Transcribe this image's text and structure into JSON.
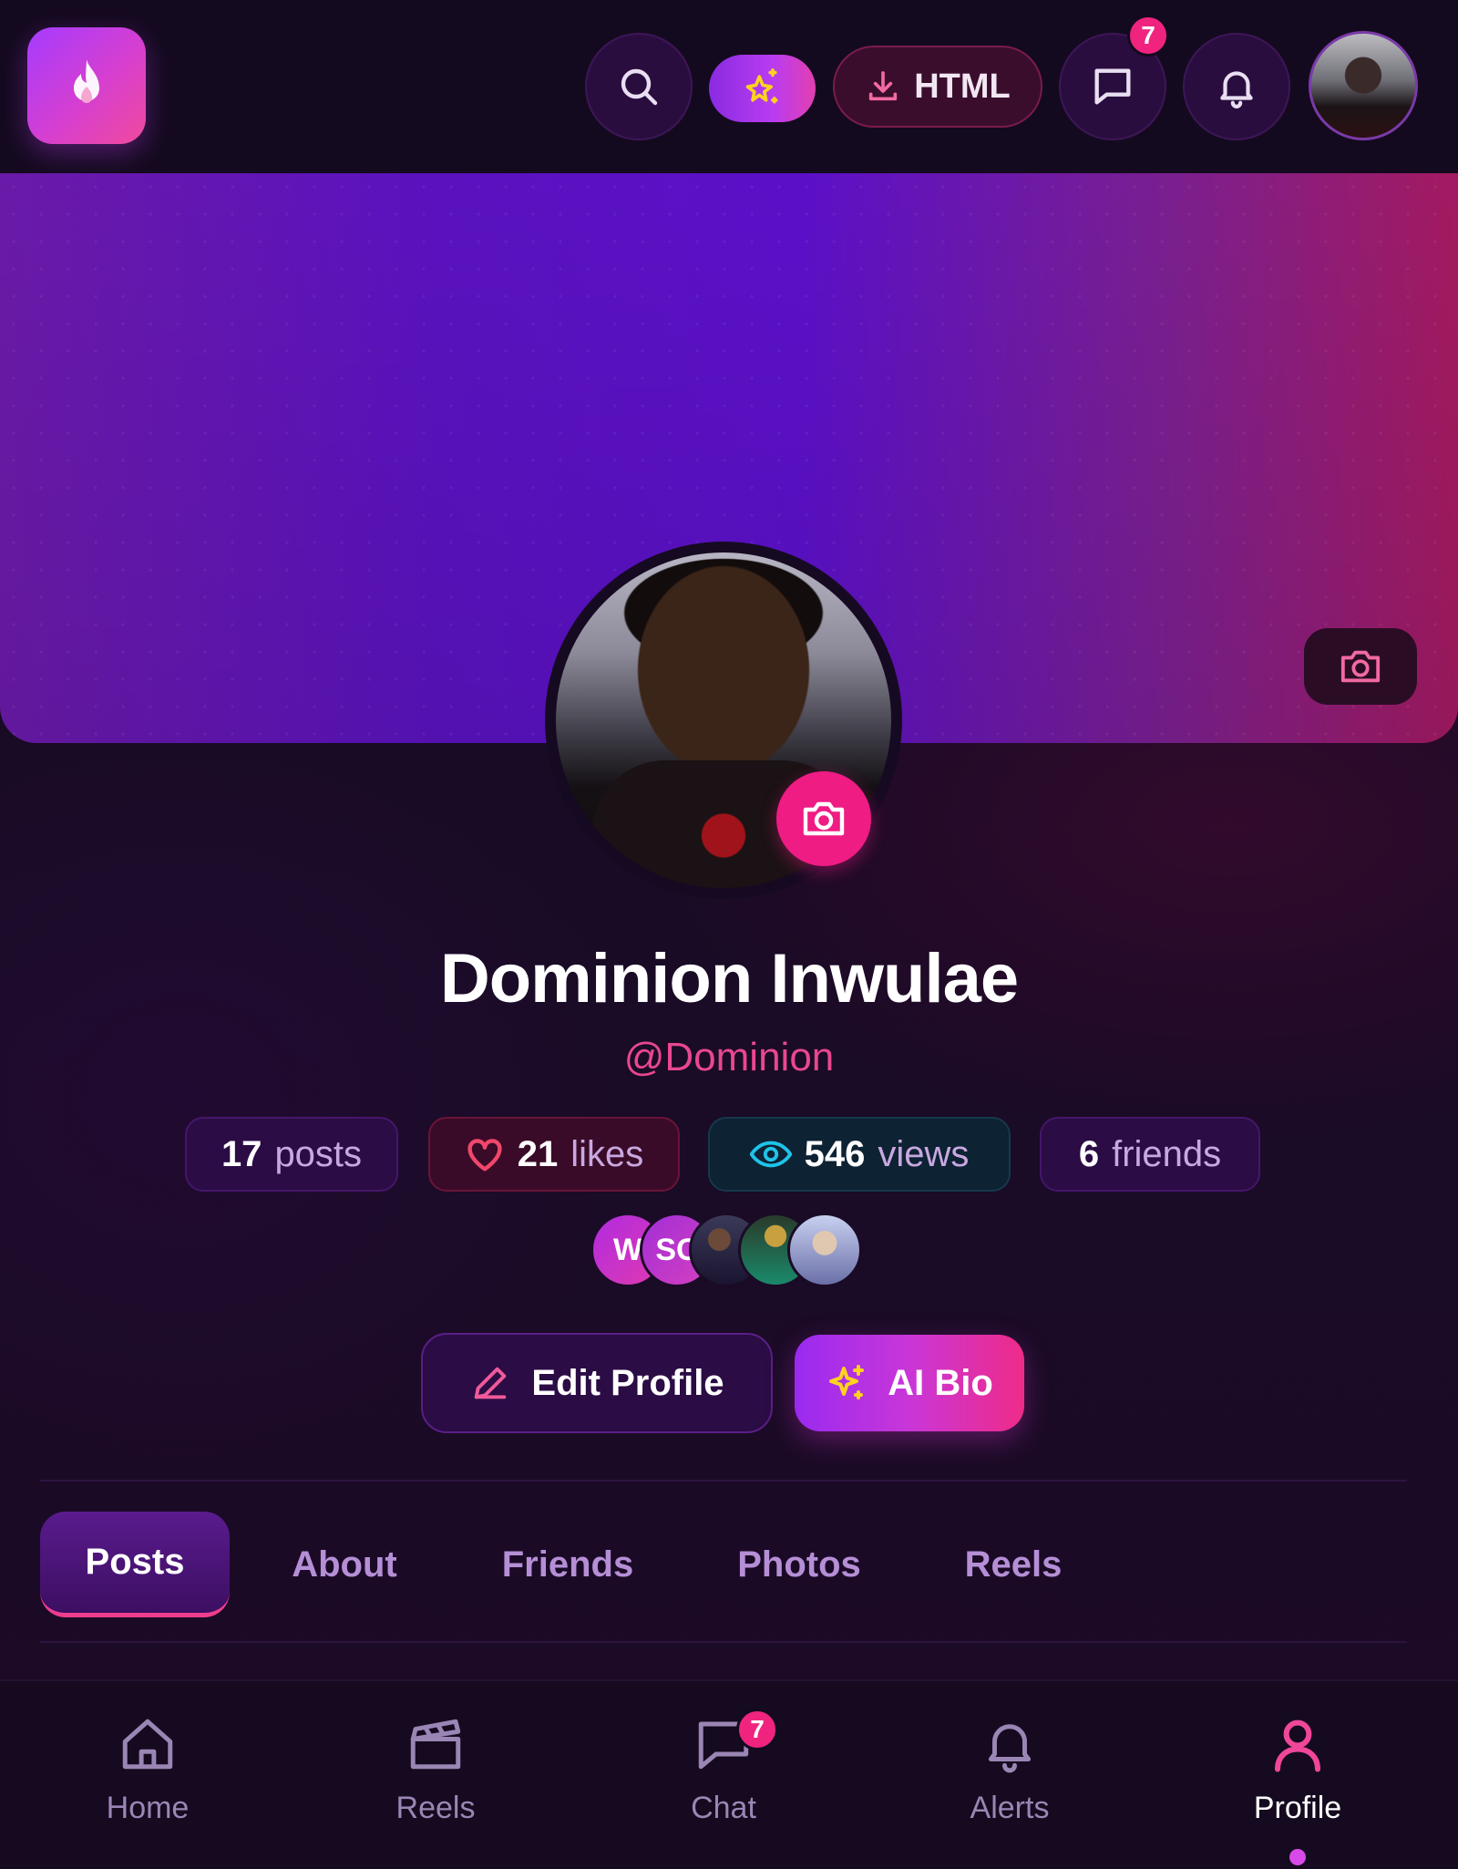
{
  "header": {
    "html_button_label": "HTML",
    "messages_badge": "7",
    "icons": [
      "flame-logo-icon",
      "search-icon",
      "magic-star-icon",
      "download-icon",
      "chat-icon",
      "bell-icon",
      "avatar"
    ]
  },
  "profile": {
    "name": "Dominion Inwulae",
    "handle": "@Dominion"
  },
  "stats": {
    "posts": {
      "value": "17",
      "label": "posts"
    },
    "likes": {
      "value": "21",
      "label": "likes"
    },
    "views": {
      "value": "546",
      "label": "views"
    },
    "friends": {
      "value": "6",
      "label": "friends"
    }
  },
  "friend_avatars": [
    {
      "initials": "W"
    },
    {
      "initials": "SC"
    },
    {
      "initials": ""
    },
    {
      "initials": ""
    },
    {
      "initials": ""
    }
  ],
  "actions": {
    "edit_profile": "Edit Profile",
    "ai_bio": "AI Bio"
  },
  "tabs": [
    {
      "label": "Posts",
      "active": true
    },
    {
      "label": "About"
    },
    {
      "label": "Friends"
    },
    {
      "label": "Photos"
    },
    {
      "label": "Reels"
    }
  ],
  "bottom_nav": [
    {
      "label": "Home"
    },
    {
      "label": "Reels"
    },
    {
      "label": "Chat",
      "badge": "7"
    },
    {
      "label": "Alerts"
    },
    {
      "label": "Profile",
      "active": true
    }
  ],
  "colors": {
    "accent_pink": "#ef1c84",
    "accent_purple": "#9a2af0",
    "background": "#160a22"
  }
}
